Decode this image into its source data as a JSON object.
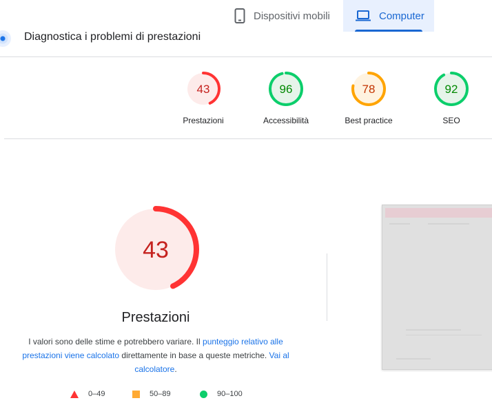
{
  "tabs": {
    "mobile": "Dispositivi mobili",
    "desktop": "Computer",
    "active": "desktop"
  },
  "section": {
    "title": "Diagnostica i problemi di prestazioni"
  },
  "categories": [
    {
      "label": "Prestazioni",
      "score": 43,
      "rating": "fail"
    },
    {
      "label": "Accessibilità",
      "score": 96,
      "rating": "pass"
    },
    {
      "label": "Best practice",
      "score": 78,
      "rating": "average"
    },
    {
      "label": "SEO",
      "score": 92,
      "rating": "pass"
    }
  ],
  "performance": {
    "score": 43,
    "title": "Prestazioni",
    "desc_prefix": "I valori sono delle stime e potrebbero variare. Il ",
    "desc_link1": "punteggio relativo alle prestazioni viene calcolato",
    "desc_middle": " direttamente in base a queste metriche. ",
    "desc_link2": "Vai al calcolatore",
    "desc_suffix": "."
  },
  "legend": {
    "fail": "0–49",
    "average": "50–89",
    "pass": "90–100"
  },
  "colors": {
    "fail": "#ff3333",
    "fail_bg": "#fdebea",
    "fail_text": "#c5221f",
    "average": "#ffa400",
    "average_bg": "#fff3e0",
    "average_text": "#c33300",
    "pass": "#0cce6b",
    "pass_bg": "#e6f4ea",
    "pass_text": "#008800",
    "accent": "#1967d2"
  }
}
